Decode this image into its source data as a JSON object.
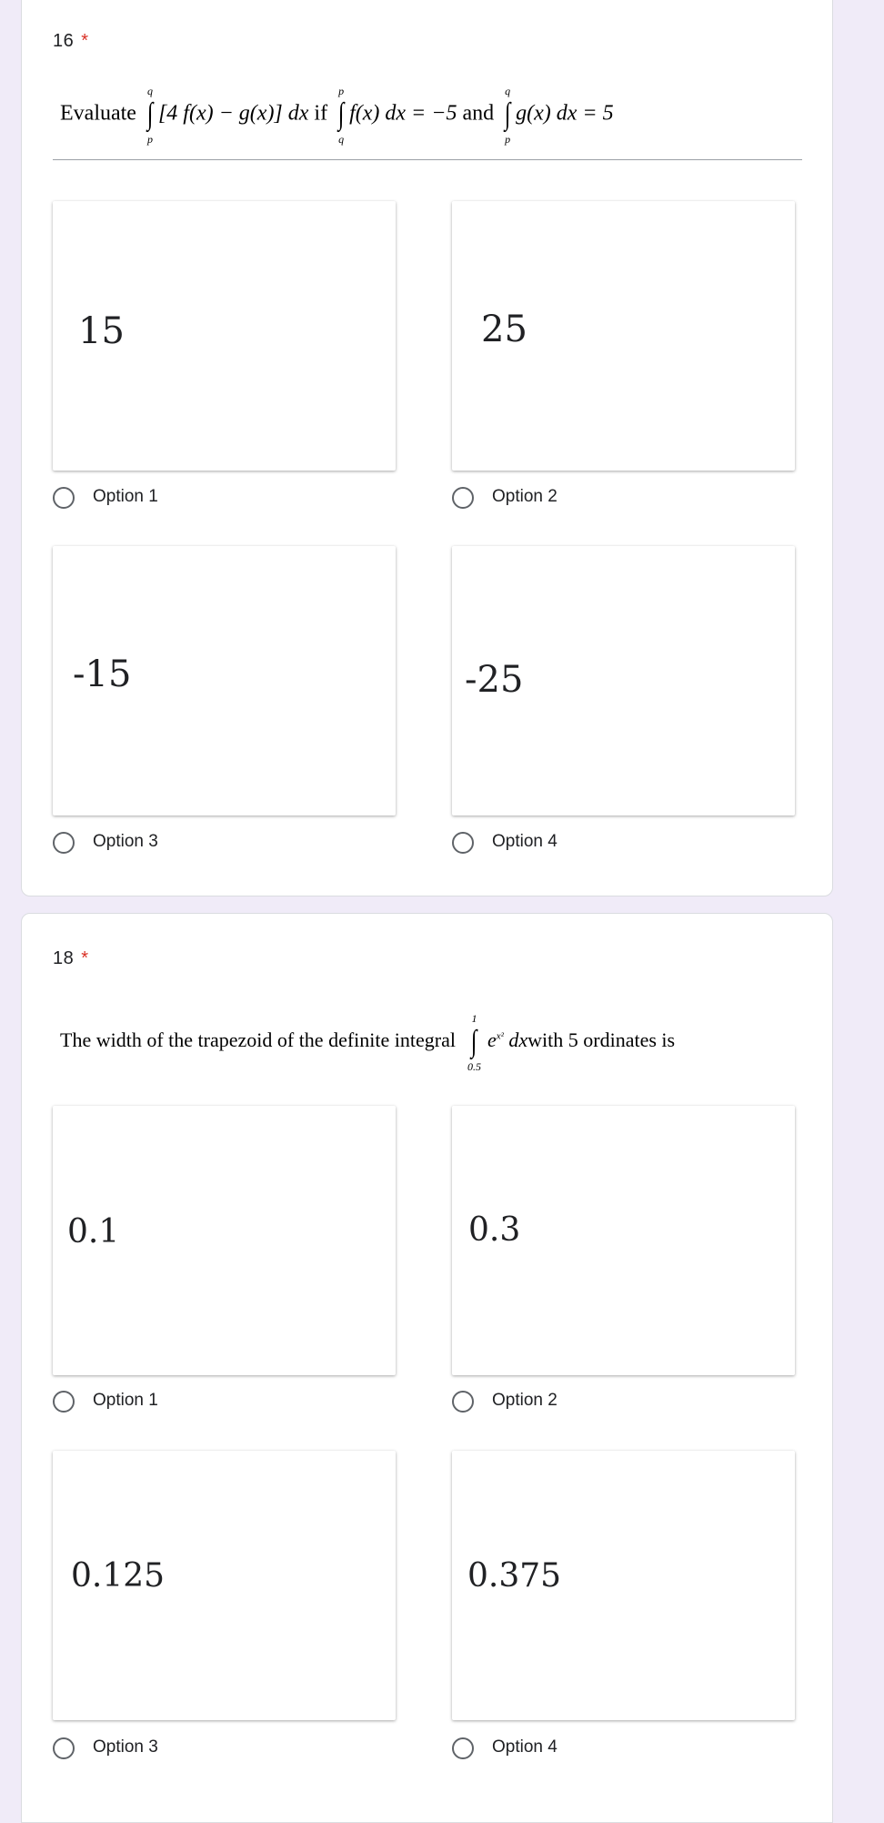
{
  "q16": {
    "number": "16",
    "required_mark": "*",
    "text": {
      "evaluate": "Evaluate",
      "integrand": "[4 f(x) − g(x)] dx",
      "if": "if",
      "f_integral": "f(x) dx = −5",
      "and": "and",
      "g_integral": "g(x) dx = 5",
      "lim1_upper": "q",
      "lim1_lower": "p",
      "lim2_upper": "p",
      "lim2_lower": "q",
      "lim3_upper": "q",
      "lim3_lower": "p"
    },
    "options": [
      {
        "image_value": "15",
        "label": "Option 1"
      },
      {
        "image_value": "25",
        "label": "Option 2"
      },
      {
        "image_value": "-15",
        "label": "Option 3"
      },
      {
        "image_value": "-25",
        "label": "Option 4"
      }
    ]
  },
  "q18": {
    "number": "18",
    "required_mark": "*",
    "text": {
      "before": "The width of the trapezoid of the definite integral",
      "upper": "1",
      "lower": "0.5",
      "integrand": "e",
      "exponent": "x²",
      "dx": "dx",
      "after": "with 5 ordinates is"
    },
    "options": [
      {
        "image_value": "0.1",
        "label": "Option 1"
      },
      {
        "image_value": "0.3",
        "label": "Option 2"
      },
      {
        "image_value": "0.125",
        "label": "Option 3"
      },
      {
        "image_value": "0.375",
        "label": "Option 4"
      }
    ]
  }
}
